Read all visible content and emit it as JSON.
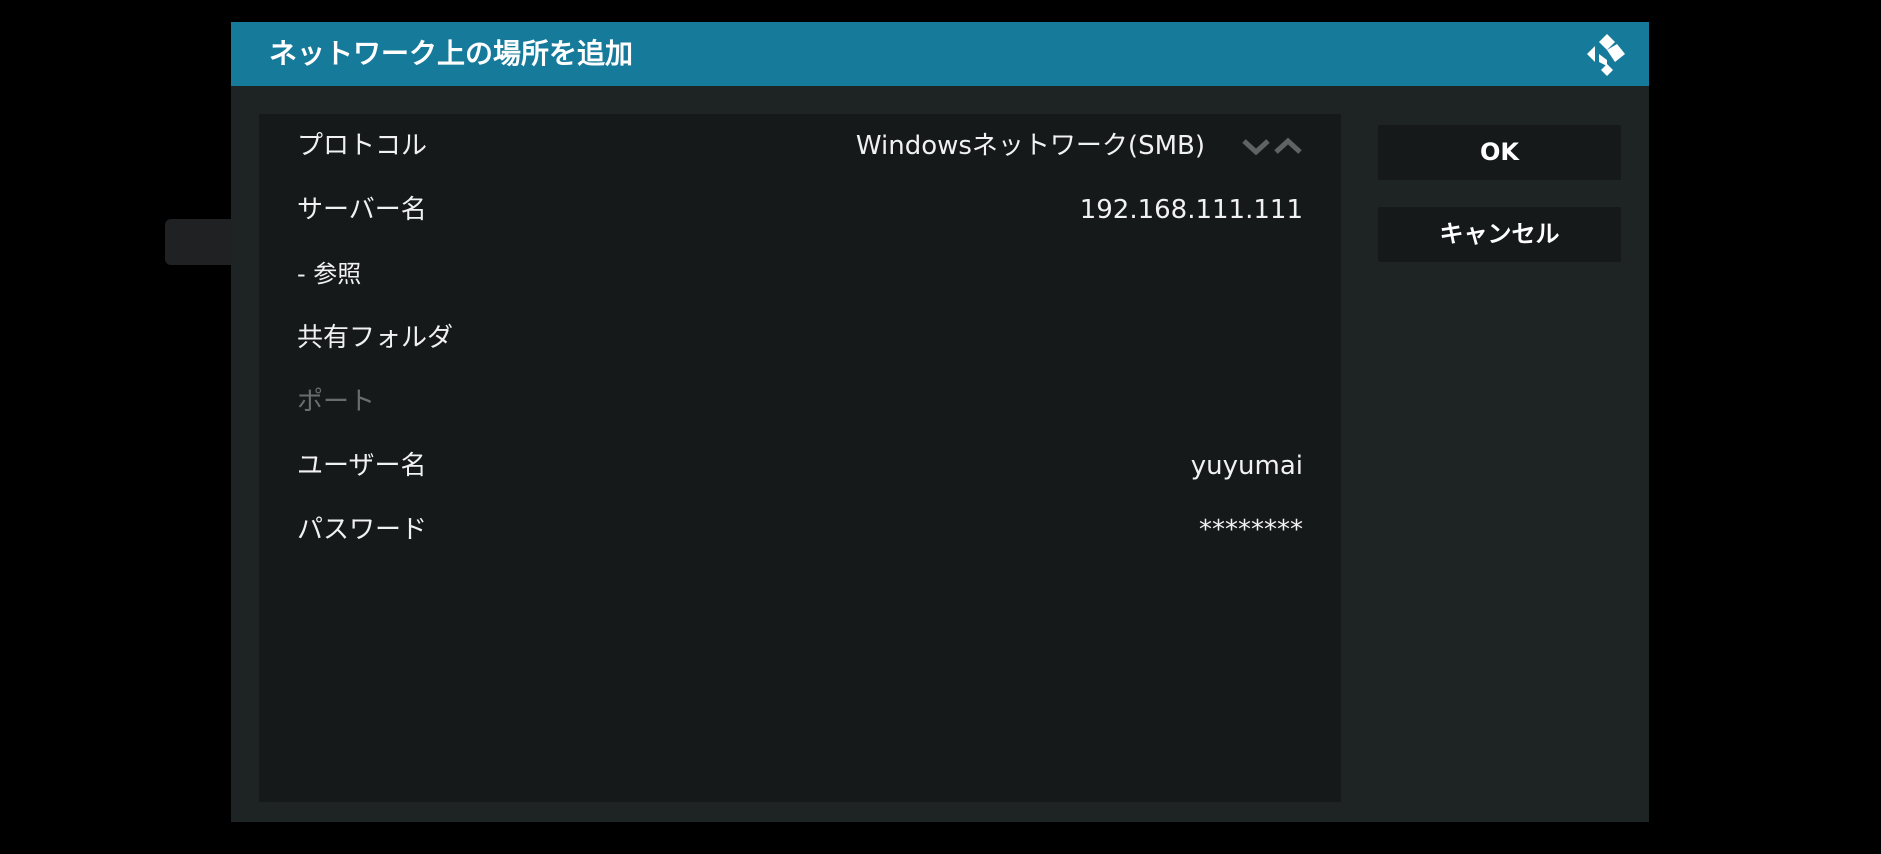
{
  "dialog": {
    "title": "ネットワーク上の場所を追加",
    "logo_icon": "kodi-logo-icon"
  },
  "settings": [
    {
      "label": "プロトコル",
      "value": "Windowsネットワーク(SMB)",
      "has_spinner": true,
      "enabled": true
    },
    {
      "label": "サーバー名",
      "value": "192.168.111.111",
      "enabled": true
    },
    {
      "label": "- 参照",
      "value": "",
      "enabled": true
    },
    {
      "label": "共有フォルダ",
      "value": "",
      "enabled": true
    },
    {
      "label": "ポート",
      "value": "",
      "enabled": false
    },
    {
      "label": "ユーザー名",
      "value": "yuyumai",
      "enabled": true
    },
    {
      "label": "パスワード",
      "value": "********",
      "enabled": true
    }
  ],
  "spinner": {
    "down_icon": "chevron-down-icon",
    "up_icon": "chevron-up-icon"
  },
  "buttons": {
    "ok_label": "OK",
    "cancel_label": "キャンセル"
  },
  "colors": {
    "header": "#167a9a",
    "dialog_bg": "#1e2324",
    "panel_bg": "#15191a",
    "text": "#f1f1f1",
    "disabled_text": "#6a6d6e"
  }
}
